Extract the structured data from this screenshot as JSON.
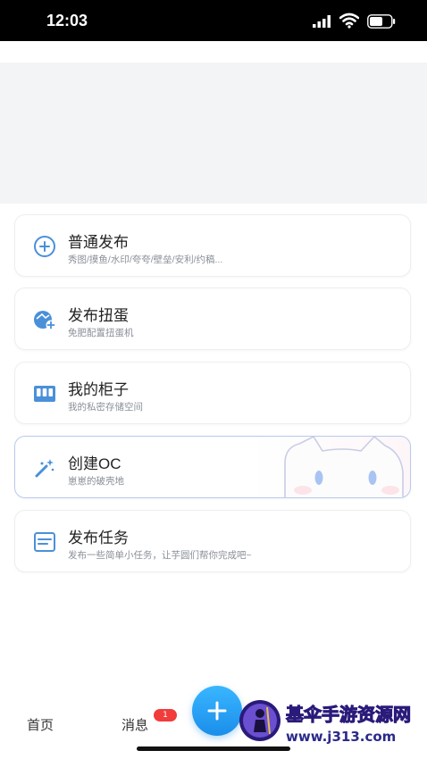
{
  "status_bar": {
    "time": "12:03"
  },
  "menu": {
    "items": [
      {
        "title": "普通发布",
        "subtitle": "秀图/摸鱼/水印/夸夸/壁垒/安利/约稿..."
      },
      {
        "title": "发布扭蛋",
        "subtitle": "免肥配置扭蛋机"
      },
      {
        "title": "我的柜子",
        "subtitle": "我的私密存储空间"
      },
      {
        "title": "创建OC",
        "subtitle": "崽崽的破壳地"
      },
      {
        "title": "发布任务",
        "subtitle": "发布一些简单小任务，让芋圆们帮你完成吧~"
      }
    ]
  },
  "bottom_nav": {
    "home": "首页",
    "messages": "消息",
    "messages_badge": "1"
  },
  "watermark": {
    "title": "基伞手游资源网",
    "url": "www.j313.com"
  },
  "colors": {
    "accent": "#1a8eea",
    "icon_blue": "#4a90d9",
    "badge_red": "#f23b3b"
  }
}
